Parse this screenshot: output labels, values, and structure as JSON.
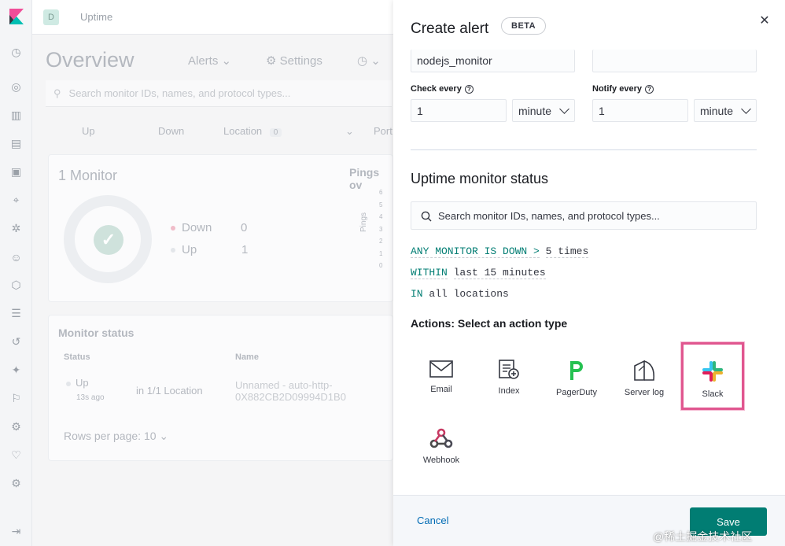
{
  "app": {
    "space_initial": "D",
    "title": "Uptime"
  },
  "background": {
    "page_title": "Overview",
    "alerts_link": "Alerts",
    "settings_link": "Settings",
    "search_placeholder": "Search monitor IDs, names, and protocol types...",
    "filters": {
      "up": "Up",
      "down": "Down",
      "location": "Location",
      "location_count": "0",
      "port": "Port"
    },
    "monitor_card": {
      "title": "1 Monitor",
      "pings_title": "Pings ov",
      "pings_axis": "Pings",
      "down_label": "Down",
      "down_value": "0",
      "up_label": "Up",
      "up_value": "1",
      "y_ticks": [
        "6",
        "5",
        "4",
        "3",
        "2",
        "1",
        "0"
      ]
    },
    "status_card": {
      "title": "Monitor status",
      "col_status": "Status",
      "col_name": "Name",
      "row": {
        "status": "Up",
        "age": "13s ago",
        "location": "in 1/1 Location",
        "name_line1": "Unnamed - auto-http-",
        "name_line2": "0X882CB2D09994D1B0"
      },
      "rows_per_page": "Rows per page: 10"
    }
  },
  "flyout": {
    "title": "Create alert",
    "beta": "BETA",
    "name_value": "nodejs_monitor",
    "tags_value": "",
    "check_every": {
      "label": "Check every",
      "value": "1",
      "unit": "minute"
    },
    "notify_every": {
      "label": "Notify every",
      "value": "1",
      "unit": "minute"
    },
    "section_title": "Uptime monitor status",
    "search_placeholder": "Search monitor IDs, names, and protocol types...",
    "expressions": [
      {
        "keyword": "ANY MONITOR IS DOWN >",
        "value": "5 times"
      },
      {
        "keyword": "WITHIN",
        "value": "last 15 minutes"
      },
      {
        "keyword": "IN",
        "value": "all locations"
      }
    ],
    "actions_title": "Actions: Select an action type",
    "actions": [
      "Email",
      "Index",
      "PagerDuty",
      "Server log",
      "Slack",
      "Webhook"
    ],
    "cancel": "Cancel",
    "save": "Save"
  },
  "watermark": "@稀土掘金技术社区",
  "colors": {
    "accent": "#017d73",
    "highlight": "#e0568f",
    "link": "#006bb4"
  }
}
